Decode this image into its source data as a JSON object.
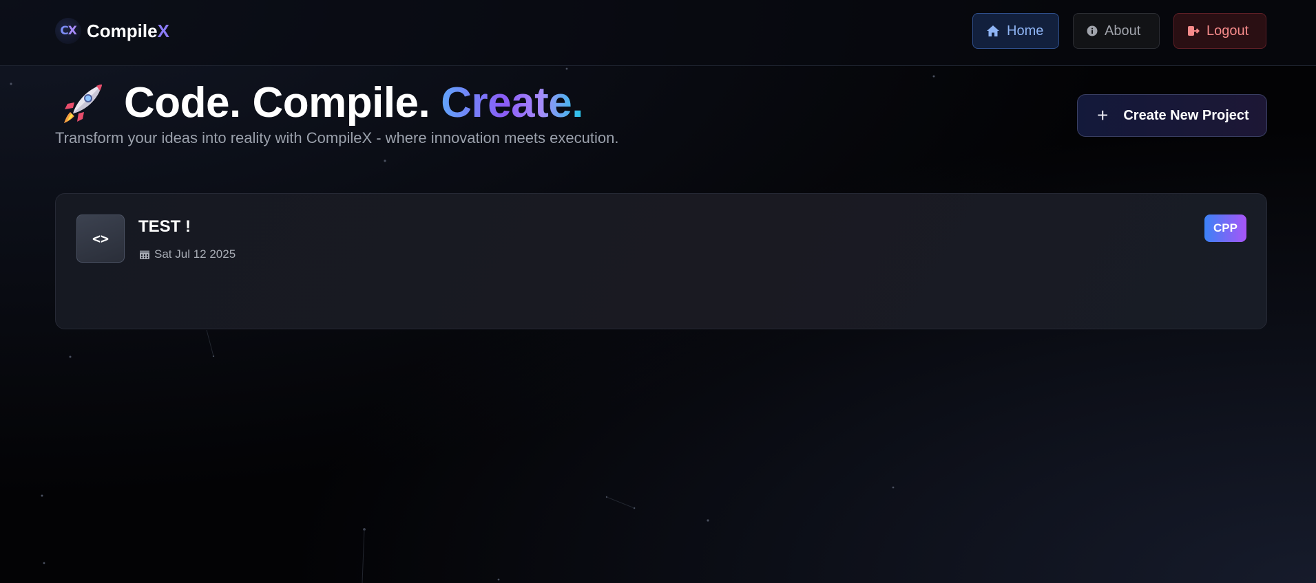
{
  "app": {
    "logo_mark": "C",
    "logo_mark_x": "X",
    "brand_prefix": "Compile",
    "brand_accent": "X"
  },
  "nav": {
    "home_label": "Home",
    "about_label": "About",
    "logout_label": "Logout"
  },
  "hero": {
    "title_part1": "Code. Compile.",
    "title_part2": "Create.",
    "subtitle": "Transform your ideas into reality with CompileX - where innovation meets execution.",
    "create_button_label": "Create New Project",
    "create_button_icon": "+"
  },
  "projects": [
    {
      "icon_text": "<>",
      "title": "TEST !",
      "date": "Sat Jul 12 2025",
      "language": "CPP"
    }
  ],
  "colors": {
    "background": "#030305",
    "accent_blue": "#60a5fa",
    "accent_purple": "#8b5cf6",
    "home_bg": "#12203d",
    "logout_bg": "#2a0f13"
  },
  "icons": [
    "rocket-icon",
    "home-icon",
    "info-icon",
    "logout-icon",
    "plus-icon",
    "code-icon",
    "calendar-icon"
  ]
}
